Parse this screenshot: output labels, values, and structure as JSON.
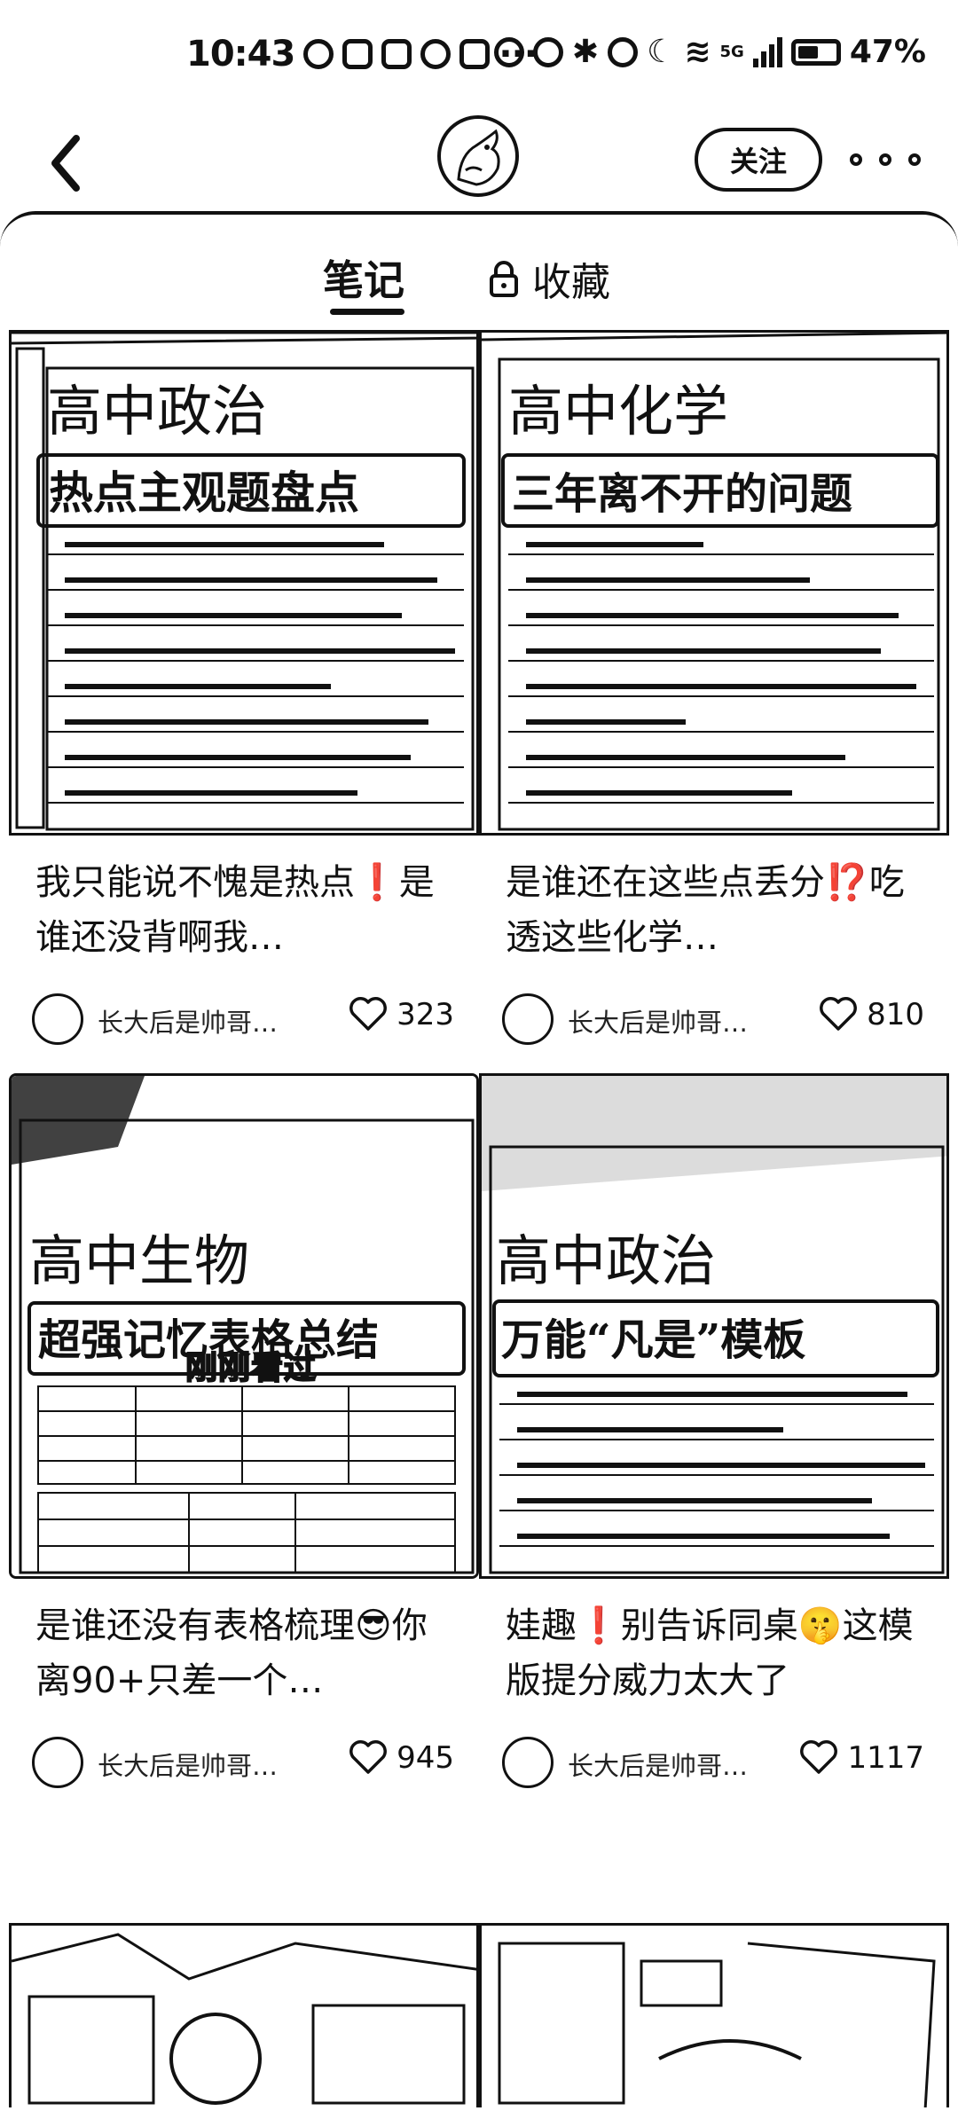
{
  "status": {
    "time": "10:43",
    "network": "5G",
    "battery": "47%"
  },
  "header": {
    "follow_label": "关注"
  },
  "tabs": {
    "notes": "笔记",
    "collections": "收藏"
  },
  "cards": [
    {
      "thumb_line1": "高中政治",
      "thumb_line2": "热点主观题盘点",
      "title": "我只能说不愧是热点❗是谁还没背啊我…",
      "author": "长大后是帅哥…",
      "likes": "323"
    },
    {
      "thumb_line1": "高中化学",
      "thumb_line2": "三年离不开的问题",
      "title": "是谁还在这些点丢分⁉️吃透这些化学…",
      "author": "长大后是帅哥…",
      "likes": "810"
    },
    {
      "thumb_line1": "高中生物",
      "thumb_line2": "超强记忆表格总结",
      "thumb_overlay": "刚刚看过",
      "title": "是谁还没有表格梳理😎你离90+只差一个…",
      "author": "长大后是帅哥…",
      "likes": "945"
    },
    {
      "thumb_line1": "高中政治",
      "thumb_line2": "万能“凡是”模板",
      "title": "娃趣❗别告诉同桌🤫这模版提分威力太大了",
      "author": "长大后是帅哥…",
      "likes": "1117"
    }
  ]
}
